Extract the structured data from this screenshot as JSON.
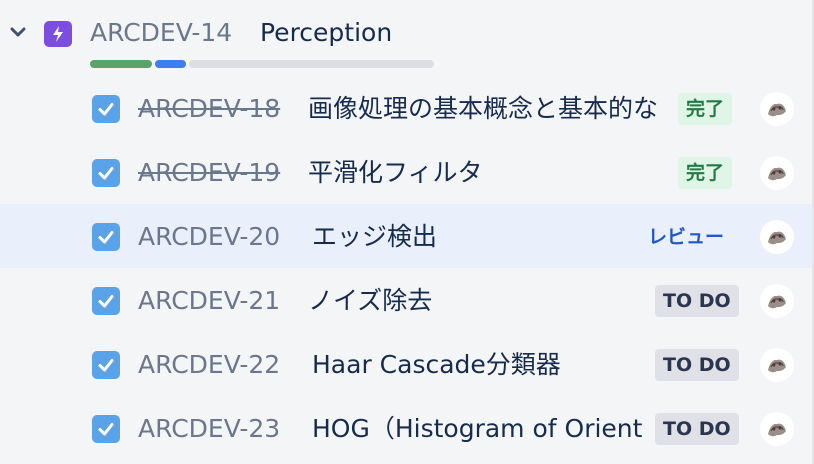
{
  "epic": {
    "key": "ARCDEV-14",
    "title": "Perception",
    "progress": {
      "done": 2,
      "in_progress": 1,
      "todo": 3
    }
  },
  "children": [
    {
      "key": "ARCDEV-18",
      "title": "画像処理の基本概念と基本的な",
      "status": "完了",
      "status_type": "done",
      "done": true,
      "highlighted": false
    },
    {
      "key": "ARCDEV-19",
      "title": "平滑化フィルタ",
      "status": "完了",
      "status_type": "done",
      "done": true,
      "highlighted": false
    },
    {
      "key": "ARCDEV-20",
      "title": "エッジ検出",
      "status": "レビュー",
      "status_type": "review",
      "done": false,
      "highlighted": true
    },
    {
      "key": "ARCDEV-21",
      "title": "ノイズ除去",
      "status": "TO DO",
      "status_type": "todo",
      "done": false,
      "highlighted": false
    },
    {
      "key": "ARCDEV-22",
      "title": "Haar Cascade分類器",
      "status": "TO DO",
      "status_type": "todo",
      "done": false,
      "highlighted": false
    },
    {
      "key": "ARCDEV-23",
      "title": "HOG（Histogram of Orient",
      "status": "TO DO",
      "status_type": "todo",
      "done": false,
      "highlighted": false
    }
  ],
  "icons": {
    "epic": "lightning-bolt-icon",
    "expand": "chevron-down-icon",
    "checkbox": "checkbox-checked-icon",
    "avatar": "user-avatar"
  },
  "colors": {
    "epic_purple": "#7b4de0",
    "progress_done": "#5aa36b",
    "progress_in_progress": "#3d7ef2",
    "checkbox_blue": "#5ba3e8",
    "highlight_row": "#e9f0fc"
  }
}
